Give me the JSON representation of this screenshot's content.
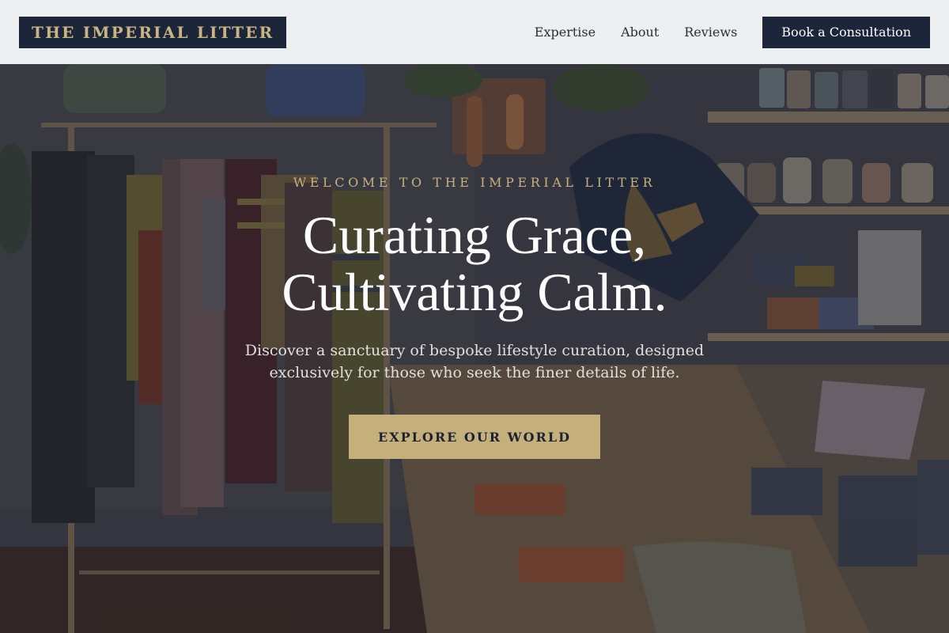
{
  "header": {
    "logo": "THE IMPERIAL LITTER",
    "nav": [
      {
        "label": "Expertise"
      },
      {
        "label": "About"
      },
      {
        "label": "Reviews"
      }
    ],
    "cta_label": "Book a Consultation"
  },
  "hero": {
    "eyebrow": "WELCOME TO THE IMPERIAL LITTER",
    "headline_line1": "Curating Grace,",
    "headline_line2": "Cultivating Calm.",
    "subtext": "Discover a sanctuary of bespoke lifestyle curation, designed exclusively for those who seek the finer details of life.",
    "cta_label": "EXPLORE OUR WORLD",
    "background_image": "boutique interior with clothing rack, hanging tote bags, shelves of ceramic cups and tables of leather goods"
  },
  "colors": {
    "navy": "#1c2539",
    "gold": "#c5b07c",
    "header_bg": "#eeeff0",
    "text_dark": "#2a2e38"
  }
}
